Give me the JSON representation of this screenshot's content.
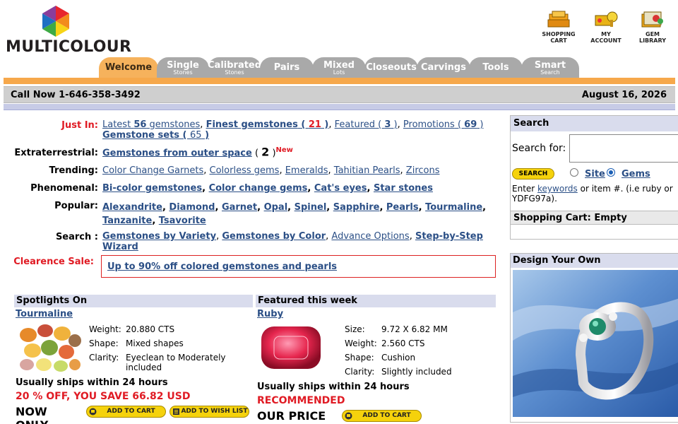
{
  "brand": {
    "name": "MULTICOLOUR"
  },
  "top_links": [
    {
      "line1": "SHOPPING",
      "line2": "CART",
      "icon": "shopping-cart-icon"
    },
    {
      "line1": "MY",
      "line2": "ACCOUNT",
      "icon": "my-account-icon"
    },
    {
      "line1": "GEM",
      "line2": "LIBRARY",
      "icon": "gem-library-icon"
    }
  ],
  "tabs": [
    {
      "label": "Welcome",
      "sub": ""
    },
    {
      "label": "Single",
      "sub": "Stones"
    },
    {
      "label": "Calibrated",
      "sub": "Stones"
    },
    {
      "label": "Pairs",
      "sub": ""
    },
    {
      "label": "Mixed",
      "sub": "Lots"
    },
    {
      "label": "Closeouts",
      "sub": ""
    },
    {
      "label": "Carvings",
      "sub": ""
    },
    {
      "label": "Tools",
      "sub": ""
    },
    {
      "label": "Smart",
      "sub": "Search"
    }
  ],
  "info_bar": {
    "call_now": "Call Now 1-646-358-3492",
    "date": "August 16, 2026"
  },
  "rows": {
    "just_in": {
      "label": "Just In:",
      "latest_pre": "Latest ",
      "latest_count": "56",
      "latest_post": " gemstones",
      "finest": "Finest gemstones",
      "finest_count": "21",
      "featured": "Featured",
      "featured_count": "3",
      "promotions": "Promotions",
      "promotions_count": "69",
      "sets": "Gemstone sets",
      "sets_count": "65"
    },
    "extra": {
      "label": "Extraterrestrial:",
      "link": "Gemstones from outer space",
      "count": "2",
      "badge": "New"
    },
    "trending": {
      "label": "Trending:",
      "links": [
        "Color Change Garnets",
        "Colorless gems",
        "Emeralds",
        "Tahitian Pearls",
        "Zircons"
      ]
    },
    "phenomenal": {
      "label": "Phenomenal:",
      "links": [
        "Bi-color gemstones",
        "Color change gems",
        "Cat's eyes",
        "Star stones"
      ]
    },
    "popular": {
      "label": "Popular:",
      "links": [
        "Alexandrite",
        "Diamond",
        "Garnet",
        "Opal",
        "Spinel",
        "Sapphire",
        "Pearls",
        "Tourmaline",
        "Tanzanite",
        "Tsavorite"
      ]
    },
    "search": {
      "label": "Search :",
      "links": [
        "Gemstones by Variety",
        "Gemstones by Color",
        "Advance Options",
        "Step-by-Step Wizard"
      ]
    },
    "clearance": {
      "label": "Clearence Sale:",
      "link": "Up to 90% off colored gemstones and pearls"
    }
  },
  "spotlight": {
    "heading": "Spotlights On",
    "name": "Tourmaline",
    "specs": [
      {
        "k": "Weight:",
        "v": "20.880 CTS"
      },
      {
        "k": "Shape:",
        "v": "Mixed shapes"
      },
      {
        "k": "Clarity:",
        "v": "Eyeclean to Moderately included"
      }
    ],
    "ships": "Usually ships within 24 hours",
    "savings": "20 % OFF, YOU SAVE 66.82 USD",
    "price_label": "NOW ONLY",
    "add_to_cart": "ADD TO CART",
    "add_to_wishlist": "ADD TO WISH LIST"
  },
  "featured": {
    "heading": "Featured this week",
    "name": "Ruby",
    "specs": [
      {
        "k": "Size:",
        "v": "9.72 X 6.82 MM"
      },
      {
        "k": "Weight:",
        "v": "2.560 CTS"
      },
      {
        "k": "Shape:",
        "v": "Cushion"
      },
      {
        "k": "Clarity:",
        "v": "Slightly included"
      }
    ],
    "ships": "Usually ships within 24 hours",
    "recommended": "RECOMMENDED",
    "price_label": "OUR PRICE",
    "add_to_cart": "ADD TO CART"
  },
  "search_panel": {
    "heading": "Search",
    "label": "Search for:",
    "button": "SEARCH",
    "opt_site": "Site",
    "opt_gems": "Gems",
    "hint_pre": "Enter ",
    "hint_link": "keywords",
    "hint_post": " or item #. (i.e ruby or YDFG97a).",
    "cart_label": "Shopping Cart:",
    "cart_value": "Empty"
  },
  "design_panel": {
    "heading": "Design Your Own"
  },
  "colors": {
    "orange": "#f6a84b",
    "tab_gray": "#a9a9a9",
    "link": "#2b4f86",
    "accent_red": "#e01b24",
    "section_head": "#d9dced"
  }
}
